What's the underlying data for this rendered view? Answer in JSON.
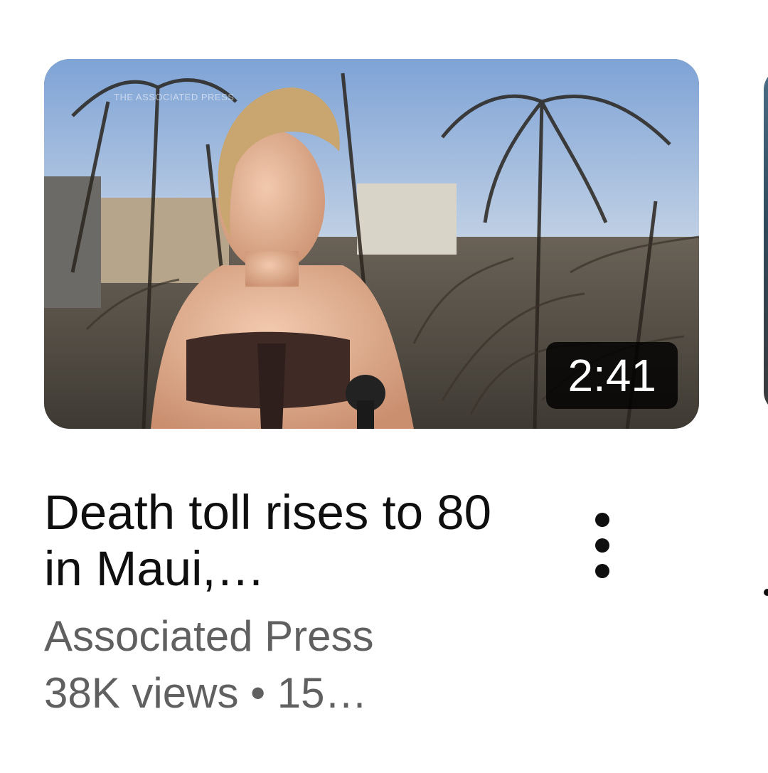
{
  "video": {
    "duration": "2:41",
    "watermark": "The Associated Press",
    "title": "Death toll rises to 80 in Maui,…",
    "channel": "Associated Press",
    "stats": "38K views • 15…",
    "thumbnail_icon": "video-thumbnail-image"
  },
  "menu": {
    "icon": "more-vertical-icon"
  }
}
